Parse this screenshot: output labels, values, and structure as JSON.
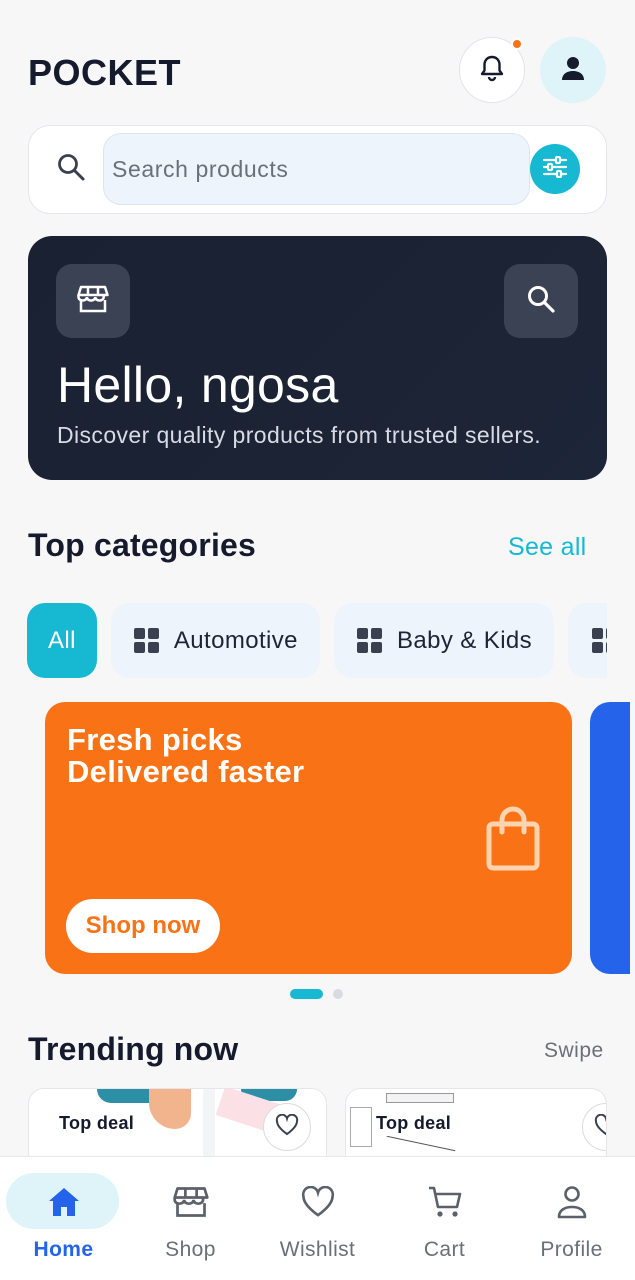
{
  "header": {
    "brand": "POCKET",
    "notification_badge": true
  },
  "search": {
    "placeholder": "Search products"
  },
  "hero": {
    "title": "Hello, ngosa",
    "subtitle": "Discover quality products from trusted sellers."
  },
  "categories": {
    "title": "Top categories",
    "see_all": "See all",
    "chips": [
      {
        "label": "All",
        "active": true
      },
      {
        "label": "Automotive",
        "active": false
      },
      {
        "label": "Baby & Kids",
        "active": false
      }
    ]
  },
  "promo": {
    "line1": "Fresh picks",
    "line2": "Delivered faster",
    "button": "Shop now",
    "color": "#f97316",
    "next_card_color": "#2563eb",
    "carousel_page": 1,
    "carousel_pages": 2
  },
  "trending": {
    "title": "Trending now",
    "hint": "Swipe",
    "cards": [
      {
        "badge": "Top deal"
      },
      {
        "badge": "Top deal"
      }
    ]
  },
  "nav": {
    "items": [
      {
        "label": "Home",
        "icon": "home-icon",
        "active": true
      },
      {
        "label": "Shop",
        "icon": "store-icon",
        "active": false
      },
      {
        "label": "Wishlist",
        "icon": "heart-icon",
        "active": false
      },
      {
        "label": "Cart",
        "icon": "cart-icon",
        "active": false
      },
      {
        "label": "Profile",
        "icon": "person-icon",
        "active": false
      }
    ]
  },
  "colors": {
    "accent": "#16b8d2",
    "primary_nav": "#2563eb",
    "hero_bg": "#1b2334",
    "text_dark": "#151a2d"
  }
}
